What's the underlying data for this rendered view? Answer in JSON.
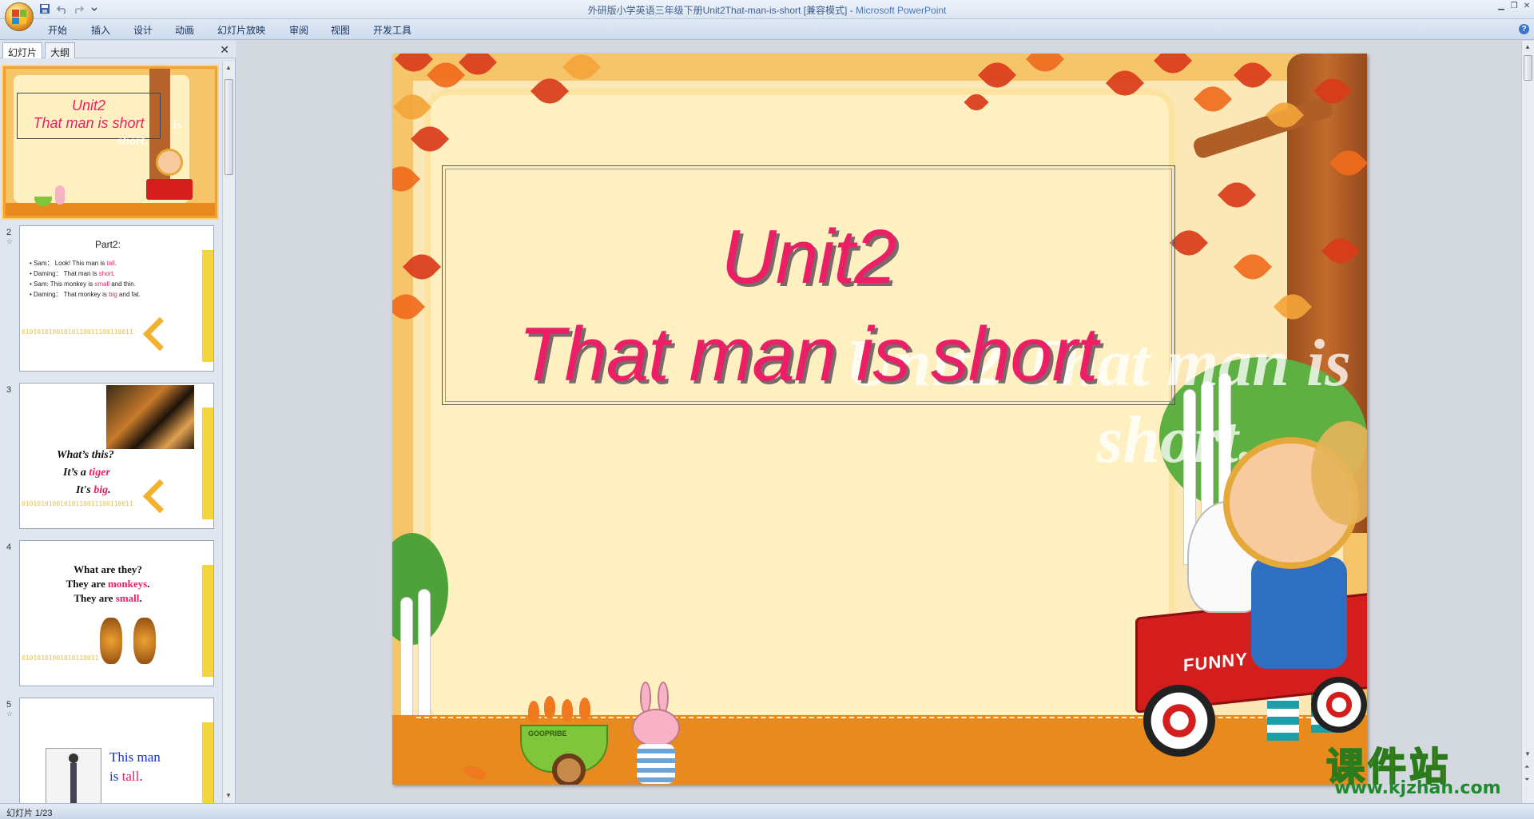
{
  "window": {
    "title_doc": "外研版小学英语三年级下册Unit2That-man-is-short [兼容模式] - ",
    "title_app": "Microsoft PowerPoint"
  },
  "ribbon": {
    "tabs": [
      "开始",
      "插入",
      "设计",
      "动画",
      "幻灯片放映",
      "审阅",
      "视图",
      "开发工具"
    ]
  },
  "left_pane": {
    "tabs": [
      "幻灯片",
      "大纲"
    ],
    "active_tab": "幻灯片"
  },
  "thumbnails": [
    {
      "num": "1",
      "title_line1": "Unit2",
      "title_line2": "That man is short",
      "ghost": "is",
      "ghost2": "short."
    },
    {
      "num": "2",
      "heading": "Part2:",
      "lines": [
        {
          "pre": "Sam：  Look! This man is ",
          "hl": "tall",
          "post": "."
        },
        {
          "pre": "Daming：  That man is ",
          "hl": "short",
          "post": "."
        },
        {
          "pre": "Sam: This  monkey is ",
          "hl": "small",
          "post": " and thin."
        },
        {
          "pre": "Daming：  That monkey is ",
          "hl": "big",
          "post": " and fat."
        }
      ],
      "binary": "01010101001010110011100110011"
    },
    {
      "num": "3",
      "line1": "What’s this?",
      "line2_pre": "It’s a ",
      "line2_hl": "tiger",
      "line3_pre": "It's ",
      "line3_hl": "big",
      "line3_post": ".",
      "binary": "01010101001010110011100110011"
    },
    {
      "num": "4",
      "line1": "What are they?",
      "line2_pre": "They are ",
      "line2_hl": "monkeys",
      "line2_post": ".",
      "line3_pre": "They are ",
      "line3_hl": "small",
      "line3_post": ".",
      "binary": "01010101001010110011"
    },
    {
      "num": "5",
      "line1": "This man",
      "line2_pre": "is ",
      "line2_hl": "tall",
      "line2_post": "."
    }
  ],
  "slide": {
    "title_line1": "Unit2",
    "title_line2": "That man is short",
    "ghost_text_line1": "Unit2 That man is",
    "ghost_text_line2": "short.",
    "wagon_text": "FUNNY WOORL",
    "cart_text": "GOOPRIBE"
  },
  "watermark": {
    "big": "课件站",
    "url": "www.kjzhan.com"
  },
  "status": {
    "slide_counter": "幻灯片 1/23"
  },
  "colors": {
    "title_pink": "#ec1e66",
    "ribbon_bg": "#cfdcee",
    "selected_thumb_border": "#f0a22c"
  }
}
